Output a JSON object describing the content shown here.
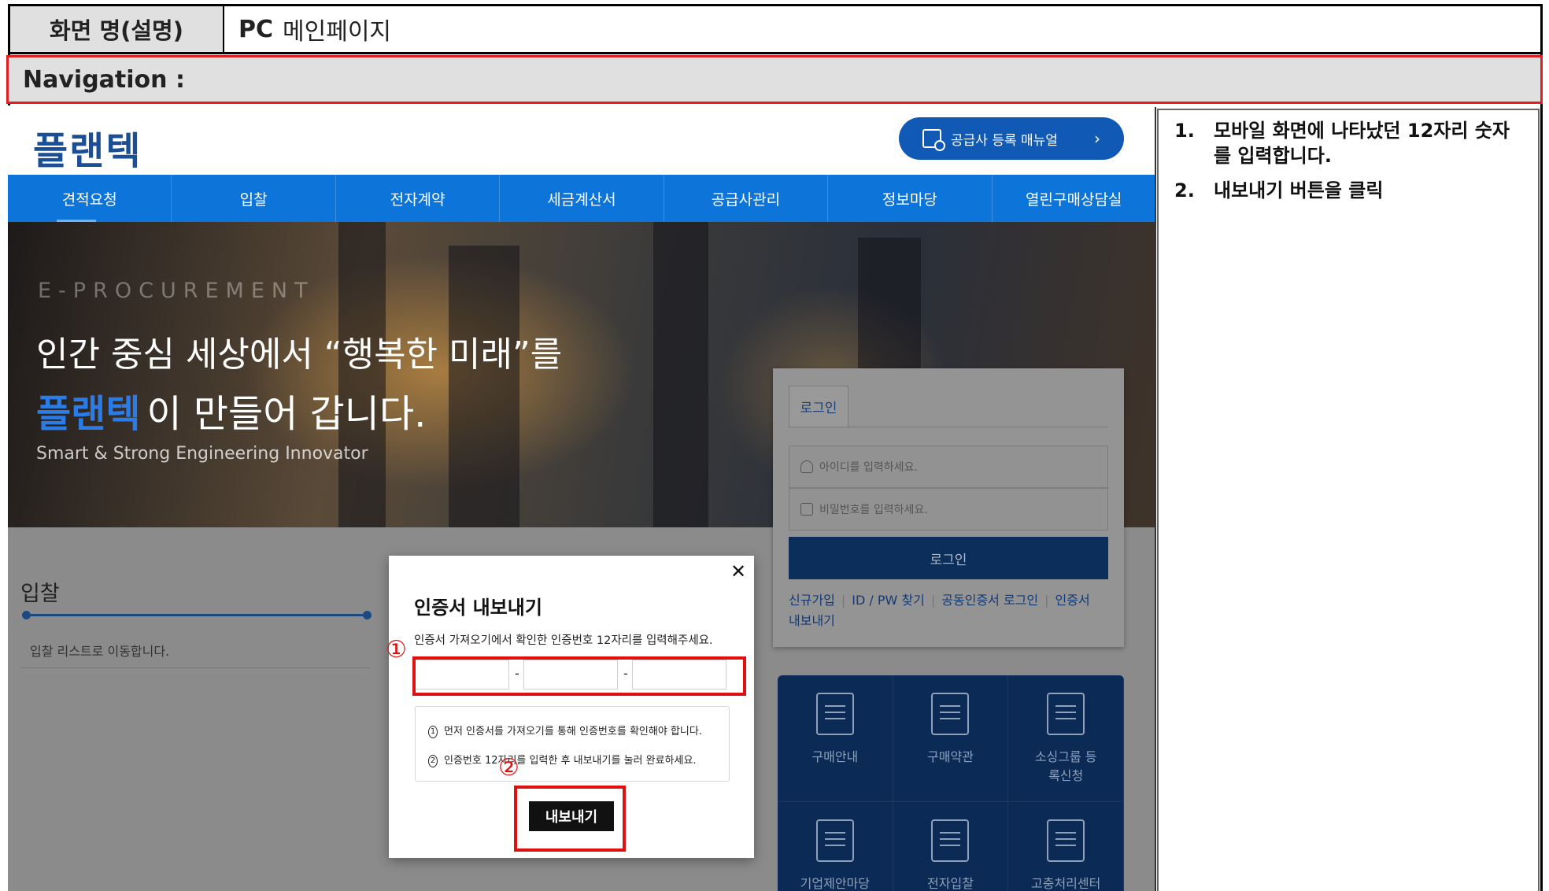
{
  "doc": {
    "screen_label": "화면 명(설명)",
    "screen_name_prefix": "PC",
    "screen_name": "메인페이지",
    "nav_label": "Navigation :"
  },
  "site": {
    "logo": "플랜텍",
    "manual_button": "공급사 등록 매뉴얼",
    "menu": [
      "견적요청",
      "입찰",
      "전자계약",
      "세금계산서",
      "공급사관리",
      "정보마당",
      "열린구매상담실"
    ],
    "hero": {
      "eyebrow": "E-PROCUREMENT",
      "line1": "인간 중심 세상에서 “행복한 미래”를",
      "brand": "플랜텍",
      "line2": "이 만들어 갑니다.",
      "sub": "Smart & Strong Engineering Innovator"
    },
    "bid": {
      "title": "입찰",
      "desc": "입찰 리스트로 이동합니다."
    },
    "login": {
      "tab": "로그인",
      "id_placeholder": "아이디를 입력하세요.",
      "pw_placeholder": "비밀번호를 입력하세요.",
      "button": "로그인",
      "links": [
        "신규가입",
        "ID / PW 찾기",
        "공동인증서 로그인",
        "인증서"
      ],
      "links_wrap": "내보내기"
    },
    "quick_menu": [
      "구매안내",
      "구매약관",
      "소싱그룹 등록신청",
      "기업제안마당",
      "전자입찰",
      "고충처리센터"
    ]
  },
  "modal": {
    "close": "✕",
    "title": "인증서 내보내기",
    "desc": "인증서 가져오기에서 확인한 인증번호 12자리를 입력해주세요.",
    "code_separator": "-",
    "notice1_num": "1",
    "notice1": "먼저 인증서를 가져오기를 통해 인증번호를 확인해야 합니다.",
    "notice2_num": "2",
    "notice2": "인증번호 12자리를 입력한 후 내보내기를 눌러 완료하세요.",
    "export_button": "내보내기"
  },
  "markers": [
    "①",
    "②"
  ],
  "instructions": [
    {
      "num": "1.",
      "text": "모바일 화면에 나타났던 12자리 숫자를 입력합니다."
    },
    {
      "num": "2.",
      "text": "내보내기 버튼을 클릭"
    }
  ],
  "colors": {
    "menu_bg": "#0d75d9",
    "brand_blue": "#1b4f95",
    "highlight_red": "#e01010",
    "overlay_gray": "#8b8b8b"
  }
}
